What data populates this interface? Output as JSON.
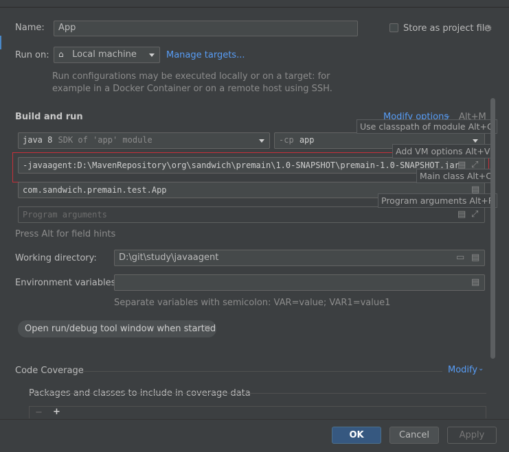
{
  "name": {
    "label": "Name:",
    "value": "App"
  },
  "store_project_file": {
    "label": "Store as project file",
    "checked": false
  },
  "run_on": {
    "label": "Run on:",
    "value": "Local machine",
    "manage_link": "Manage targets...",
    "description_line1": "Run configurations may be executed locally or on a target: for",
    "description_line2": "example in a Docker Container or on a remote host using SSH."
  },
  "build_and_run": {
    "heading": "Build and run",
    "modify_options": "Modify options",
    "modify_shortcut": "Alt+M",
    "jdk_version": "java 8",
    "jdk_hint": "SDK of 'app' module",
    "cp_prefix": "-cp",
    "cp_value": "app",
    "vm_options": "-javaagent:D:\\MavenRepository\\org\\sandwich\\premain\\1.0-SNAPSHOT\\premain-1.0-SNAPSHOT.jar",
    "main_class": "com.sandwich.premain.test.App",
    "program_args_placeholder": "Program arguments",
    "press_alt_hint": "Press Alt for field hints"
  },
  "tooltips": {
    "classpath": "Use classpath of module Alt+O",
    "vm_options": "Add VM options Alt+V",
    "main_class": "Main class Alt+C",
    "program_args": "Program arguments Alt+R"
  },
  "working_directory": {
    "label": "Working directory:",
    "value": "D:\\git\\study\\javaagent"
  },
  "environment_variables": {
    "label": "Environment variables:",
    "value": "",
    "hint": "Separate variables with semicolon: VAR=value; VAR1=value1"
  },
  "chip": {
    "label": "Open run/debug tool window when started",
    "close": "×"
  },
  "code_coverage": {
    "heading": "Code Coverage",
    "modify": "Modify",
    "packages_label": "Packages and classes to include in coverage data",
    "remove": "−",
    "add": "+"
  },
  "footer": {
    "ok": "OK",
    "cancel": "Cancel",
    "apply": "Apply"
  },
  "colors": {
    "accent": "#589df6",
    "highlight_border": "#c8303a",
    "primary_button": "#365880"
  }
}
